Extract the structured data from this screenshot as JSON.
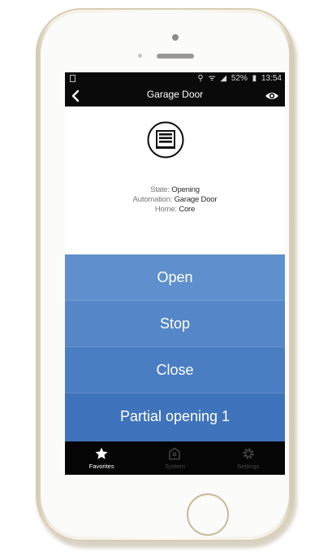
{
  "status_bar": {
    "icons": [
      "location-icon",
      "wifi-icon",
      "signal-icon",
      "battery-icon"
    ],
    "battery": "52%",
    "time": "13:54"
  },
  "nav": {
    "title": "Garage Door",
    "back_icon": "chevron-left-icon",
    "visibility_icon": "eye-icon"
  },
  "device": {
    "icon": "garage-door-icon",
    "state_label": "State:",
    "state_value": "Opening",
    "automation_label": "Automation:",
    "automation_value": "Garage Door",
    "home_label": "Home:",
    "home_value": "Core"
  },
  "actions": [
    {
      "label": "Open",
      "color": "#5f8fcc"
    },
    {
      "label": "Stop",
      "color": "#5586c7"
    },
    {
      "label": "Close",
      "color": "#4a7dc2"
    },
    {
      "label": "Partial opening 1",
      "color": "#3f73bb"
    }
  ],
  "tabs": [
    {
      "label": "Favorites",
      "icon": "star-icon",
      "active": true
    },
    {
      "label": "System",
      "icon": "house-icon",
      "active": false
    },
    {
      "label": "Settings",
      "icon": "gear-icon",
      "active": false
    }
  ],
  "colors": {
    "bar_background": "#0a0a0a",
    "accent": "#4a7dc2"
  }
}
